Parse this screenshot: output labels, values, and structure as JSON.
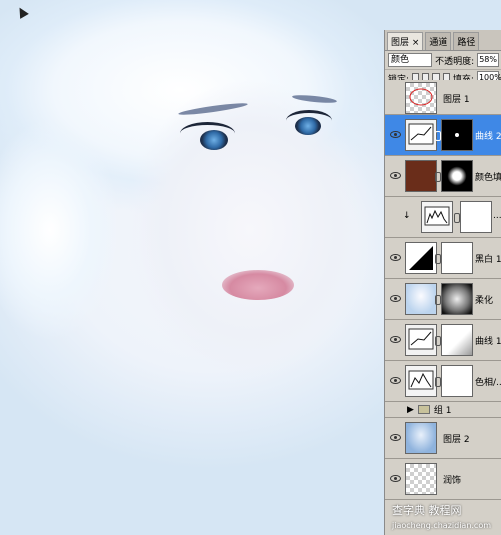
{
  "panel": {
    "tabs": [
      "图层 ×",
      "通道",
      "路径"
    ],
    "blend_mode": "颜色",
    "opacity_label": "不透明度:",
    "opacity_value": "58%",
    "lock_label": "锁定:",
    "fill_label": "填充:",
    "fill_value": "100%"
  },
  "layers": [
    {
      "name": "图层 1",
      "selected": false
    },
    {
      "name": "曲线 2",
      "selected": true
    },
    {
      "name": "颜色填...",
      "selected": false
    },
    {
      "name": "...",
      "selected": false
    },
    {
      "name": "黑白 1",
      "selected": false
    },
    {
      "name": "柔化",
      "selected": false
    },
    {
      "name": "曲线 1",
      "selected": false
    },
    {
      "name": "色相/...",
      "selected": false
    }
  ],
  "group": {
    "name": "组 1"
  },
  "layers_after": [
    {
      "name": "图层 2"
    },
    {
      "name": "润饰"
    }
  ],
  "watermark": {
    "text": "查字典",
    "sub": "教程网",
    "url": "jiaocheng.chazidian.com"
  },
  "colors": {
    "selected": "#3f88e6",
    "panel": "#d4d0c8",
    "fill_swatch": "#6a2d1a"
  },
  "icons": [
    "eye-icon",
    "chain-icon",
    "folder-icon",
    "lock-icon",
    "cursor-icon"
  ]
}
